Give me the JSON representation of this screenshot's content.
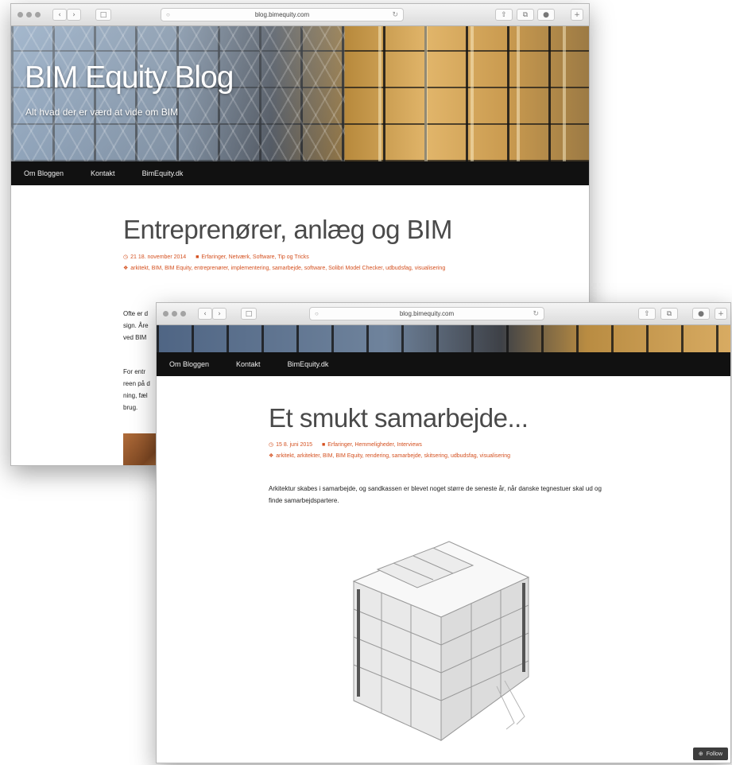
{
  "browser": {
    "url": "blog.bimequity.com",
    "back_icon": "‹",
    "forward_icon": "›",
    "sidebar_icon": "□",
    "share_icon": "⇧",
    "tabs_icon": "⧉",
    "extension_icon": "●",
    "lock_icon": "○",
    "reload_icon": "↻"
  },
  "site": {
    "title": "BIM Equity Blog",
    "tagline": "Alt hvad der er værd at vide om BIM",
    "nav": [
      "Om Bloggen",
      "Kontakt",
      "BimEquity.dk"
    ]
  },
  "posts": [
    {
      "title": "Entreprenører, anlæg og BIM",
      "date": "21 18. november 2014",
      "categories": "Erfaringer, Netværk, Software, Tip og Tricks",
      "tags": "arkitekt, BIM, BIM Equity, entreprenører, implementering, samarbejde, software, Solibri Model Checker, udbudsfag, visualisering",
      "text_fragments": [
        "Ofte er d",
        "sign. Åre",
        "ved BIM",
        "For entr",
        "reen på d",
        "ning, fæl",
        "brug."
      ]
    },
    {
      "title": "Et smukt samarbejde...",
      "date": "15 8. juni 2015",
      "categories": "Erfaringer, Hemmeligheder, Interviews",
      "tags": "arkitekt, arkitekter, BIM, BIM Equity, rendering, samarbejde, skitsering, udbudsfag, visualisering",
      "text": "Arkitektur skabes i samarbejde, og sandkassen er blevet noget større de seneste år, når danske tegnestuer skal ud og finde samarbejdspartere."
    }
  ],
  "follow": {
    "icon": "⊕",
    "label": "Follow"
  },
  "colors": {
    "accent": "#d4501f",
    "nav_bg": "#111111",
    "title": "#4a4a4a"
  }
}
